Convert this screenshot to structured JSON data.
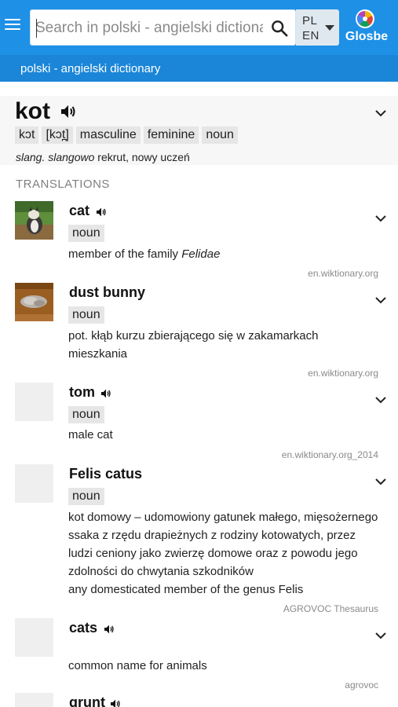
{
  "header": {
    "search_placeholder": "Search in polski - angielski dictionary",
    "lang_from": "PL",
    "lang_to": "EN",
    "logo_text": "Glosbe"
  },
  "subbar": {
    "title": "polski - angielski dictionary"
  },
  "headword": {
    "word": "kot",
    "tags": [
      "kɔt",
      "[kɔt̪]",
      "masculine",
      "feminine",
      "noun"
    ],
    "def_label": "slang. slangowo",
    "def_text": " rekrut, nowy uczeń"
  },
  "section_label": "TRANSLATIONS",
  "translations": [
    {
      "word": "cat",
      "pos": "noun",
      "desc_plain": "member of the family ",
      "desc_italic": "Felidae",
      "source": "en.wiktionary.org"
    },
    {
      "word": "dust bunny",
      "pos": "noun",
      "desc": "pot. kłąb kurzu zbierającego się w zakamarkach mieszkania",
      "source": "en.wiktionary.org"
    },
    {
      "word": "tom",
      "pos": "noun",
      "desc": "male cat",
      "source": "en.wiktionary.org_2014"
    },
    {
      "word": "Felis catus",
      "pos": "noun",
      "desc": "kot domowy – udomowiony gatunek małego, mięsożernego ssaka z rzędu drapieżnych z rodziny kotowatych, przez ludzi ceniony jako zwierzę domowe oraz z powodu jego zdolności do chwytania szkodników",
      "desc2": "any domesticated member of the genus Felis",
      "source": "AGROVOC Thesaurus"
    },
    {
      "word": "cats",
      "desc": "common name for animals",
      "source": "agrovoc"
    },
    {
      "word": "grunt"
    }
  ]
}
